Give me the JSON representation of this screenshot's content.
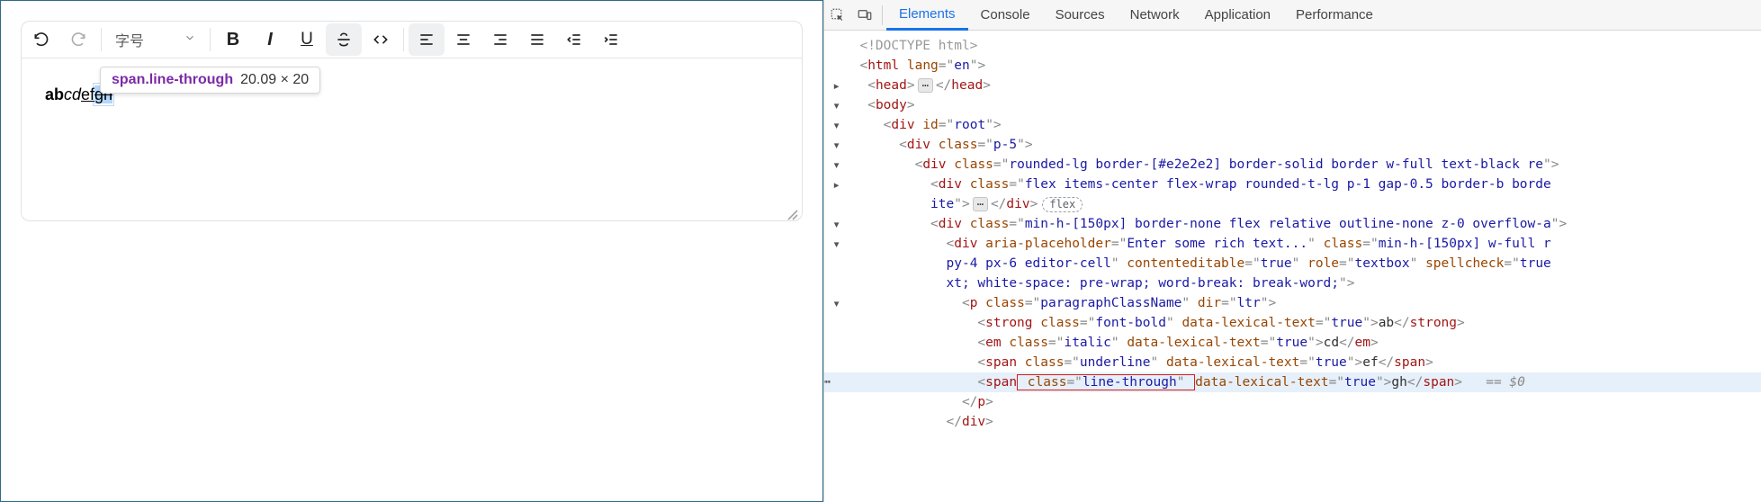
{
  "toolbar": {
    "fontsize_label": "字号"
  },
  "tooltip": {
    "selector": "span.line-through",
    "dims": "20.09 × 20"
  },
  "editor": {
    "text_ab": "ab",
    "text_cd": "cd",
    "text_ef": "ef",
    "text_gh": "gh"
  },
  "devtools": {
    "tabs": {
      "elements": "Elements",
      "console": "Console",
      "sources": "Sources",
      "network": "Network",
      "application": "Application",
      "performance": "Performance"
    },
    "flex_badge": "flex",
    "pseudo_hint": "== $0",
    "ellipsis": "⋯",
    "dom": {
      "doctype": "<!DOCTYPE html>",
      "html_open": {
        "tag": "html",
        "attrs": [
          [
            "lang",
            "en"
          ]
        ]
      },
      "head": {
        "tag": "head"
      },
      "body": {
        "tag": "body"
      },
      "div_root": {
        "tag": "div",
        "attrs": [
          [
            "id",
            "root"
          ]
        ]
      },
      "div_p5": {
        "tag": "div",
        "attrs": [
          [
            "class",
            "p-5"
          ]
        ]
      },
      "div_rounded": {
        "tag": "div",
        "attrs": [
          [
            "class",
            "rounded-lg border-[#e2e2e2] border-solid border w-full text-black re"
          ]
        ]
      },
      "div_flex_toolbar": {
        "open_pre": "<div class=\"flex items-center flex-wrap rounded-t-lg p-1 gap-0.5 border-b borde",
        "open_cont": "ite\">",
        "close": "</div>"
      },
      "div_minh": {
        "tag": "div",
        "attrs": [
          [
            "class",
            "min-h-[150px] border-none flex relative outline-none z-0 overflow-a"
          ]
        ]
      },
      "div_editor": {
        "l1": "<div aria-placeholder=\"Enter some rich text...\" class=\"min-h-[150px] w-full r",
        "l2": "py-4 px-6 editor-cell\" contenteditable=\"true\" role=\"textbox\" spellcheck=\"true",
        "l3": "xt; white-space: pre-wrap; word-break: break-word;\">"
      },
      "p_para": {
        "tag": "p",
        "attrs": [
          [
            "class",
            "paragraphClassName"
          ],
          [
            "dir",
            "ltr"
          ]
        ]
      },
      "strong": {
        "tag": "strong",
        "attrs": [
          [
            "class",
            "font-bold"
          ],
          [
            "data-lexical-text",
            "true"
          ]
        ],
        "text": "ab"
      },
      "em": {
        "tag": "em",
        "attrs": [
          [
            "class",
            "italic"
          ],
          [
            "data-lexical-text",
            "true"
          ]
        ],
        "text": "cd"
      },
      "span_under": {
        "tag": "span",
        "attrs": [
          [
            "class",
            "underline"
          ],
          [
            "data-lexical-text",
            "true"
          ]
        ],
        "text": "ef"
      },
      "span_strike_pre": "<span",
      "span_strike_hl": " class=\"line-through\" ",
      "span_strike_post_attr": "data-lexical-text=\"true\">",
      "span_strike_text": "gh",
      "span_strike_close": "</span>",
      "p_close": "</p>",
      "div_close": "</div>"
    }
  }
}
